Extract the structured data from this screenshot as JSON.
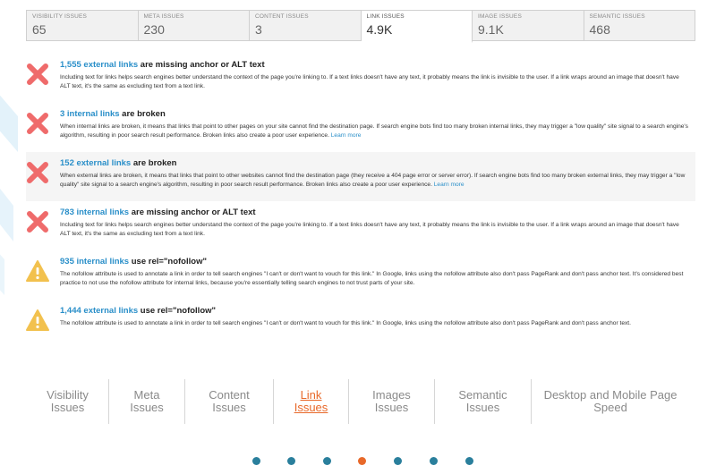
{
  "tabs": [
    {
      "label": "VISIBILITY ISSUES",
      "value": "65",
      "active": false
    },
    {
      "label": "META ISSUES",
      "value": "230",
      "active": false
    },
    {
      "label": "CONTENT ISSUES",
      "value": "3",
      "active": false
    },
    {
      "label": "LINK ISSUES",
      "value": "4.9K",
      "active": true
    },
    {
      "label": "IMAGE ISSUES",
      "value": "9.1K",
      "active": false
    },
    {
      "label": "SEMANTIC ISSUES",
      "value": "468",
      "active": false
    }
  ],
  "issues": [
    {
      "icon": "error-x-icon",
      "link_text": "1,555 external links",
      "title_rest": " are missing anchor or ALT text",
      "description": "Including text for links helps search engines better understand the context of the page you're linking to. If a text links doesn't have any text, it probably means the link is invisible to the user. If a link wraps around an image that doesn't have ALT text, it's the same as excluding text from a text link.",
      "more": ""
    },
    {
      "icon": "error-x-icon",
      "link_text": "3 internal links",
      "title_rest": " are broken",
      "description": "When internal links are broken, it means that links that point to other pages on your site cannot find the destination page. If search engine bots find too many broken internal links, they may trigger a \"low quality\" site signal to a search engine's algorithm, resulting in poor search result performance. Broken links also create a poor user experience. ",
      "more": "Learn more"
    },
    {
      "icon": "error-x-icon",
      "link_text": "152 external links",
      "title_rest": " are broken",
      "description": "When external links are broken, it means that links that point to other websites cannot find the destination page (they receive a 404 page error or server error). If search engine bots find too many broken external links, they may trigger a \"low quality\" site signal to a search engine's algorithm, resulting in poor search result performance. Broken links also create a poor user experience. ",
      "more": "Learn more"
    },
    {
      "icon": "error-x-icon",
      "link_text": "783 internal links",
      "title_rest": " are missing anchor or ALT text",
      "description": "Including text for links helps search engines better understand the context of the page you're linking to. If a text links doesn't have any text, it probably means the link is invisible to the user. If a link wraps around an image that doesn't have ALT text, it's the same as excluding text from a text link.",
      "more": ""
    },
    {
      "icon": "warning-triangle-icon",
      "link_text": "935 internal links",
      "title_rest": " use rel=\"nofollow\"",
      "description": "The nofollow attribute is used to annotate a link in order to tell search engines \"I can't or don't want to vouch for this link.\" In Google, links using the nofollow attribute also don't pass PageRank and don't pass anchor text. It's considered best practice to not use the nofollow attribute for internal links, because you're essentially telling search engines to not trust parts of your site.",
      "more": ""
    },
    {
      "icon": "warning-triangle-icon",
      "link_text": "1,444 external links",
      "title_rest": " use rel=\"nofollow\"",
      "description": "The nofollow attribute is used to annotate a link in order to tell search engines \"I can't or don't want to vouch for this link.\" In Google, links using the nofollow attribute also don't pass PageRank and don't pass anchor text.",
      "more": ""
    }
  ],
  "nav": [
    {
      "line1": "Visibility",
      "line2": "Issues",
      "active": false
    },
    {
      "line1": "Meta",
      "line2": "Issues",
      "active": false
    },
    {
      "line1": "Content",
      "line2": "Issues",
      "active": false
    },
    {
      "line1": "Link",
      "line2": "Issues",
      "active": true
    },
    {
      "line1": "Images",
      "line2": "Issues",
      "active": false
    },
    {
      "line1": "Semantic",
      "line2": "Issues",
      "active": false
    },
    {
      "line1": "Desktop and Mobile Page",
      "line2": "Speed",
      "active": false
    }
  ],
  "carousel": {
    "count": 7,
    "active_index": 3
  },
  "colors": {
    "accent": "#e8692a",
    "link": "#2a8fc9",
    "dot": "#2a7f9c",
    "error": "#ef6b6b",
    "warning": "#f2c14e"
  }
}
